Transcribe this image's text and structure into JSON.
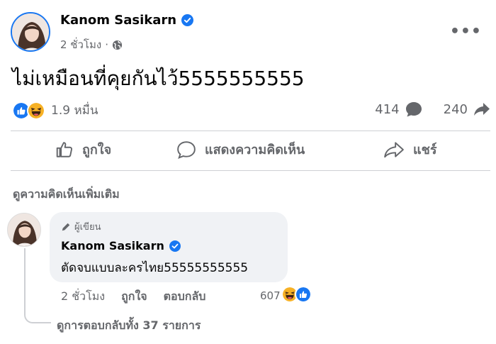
{
  "post": {
    "author": "Kanom Sasikarn",
    "time": "2 ชั่วโมง",
    "text": "ไม่เหมือนที่คุยกันไว้5555555555",
    "reaction_count": "1.9 หมื่น",
    "comment_count": "414",
    "share_count": "240"
  },
  "actions": {
    "like": "ถูกใจ",
    "comment": "แสดงความคิดเห็น",
    "share": "แชร์"
  },
  "comments": {
    "view_more": "ดูความคิดเห็นเพิ่มเติม",
    "top": {
      "badge": "ผู้เขียน",
      "author": "Kanom Sasikarn",
      "text": "ตัดจบแบบละครไทย55555555555",
      "time": "2 ชั่วโมง",
      "like": "ถูกใจ",
      "reply": "ตอบกลับ",
      "reaction_count": "607"
    },
    "view_replies": "ดูการตอบกลับทั้ง 37 รายการ"
  },
  "icons": [
    "verified-icon",
    "globe-icon",
    "more-icon",
    "like-reaction-icon",
    "haha-reaction-icon",
    "comment-icon",
    "share-icon",
    "thumbs-up-icon",
    "pencil-icon"
  ],
  "colors": {
    "brand": "#1877f2",
    "muted": "#65676b",
    "bubble": "#f0f2f5",
    "haha": "#f7b125"
  }
}
